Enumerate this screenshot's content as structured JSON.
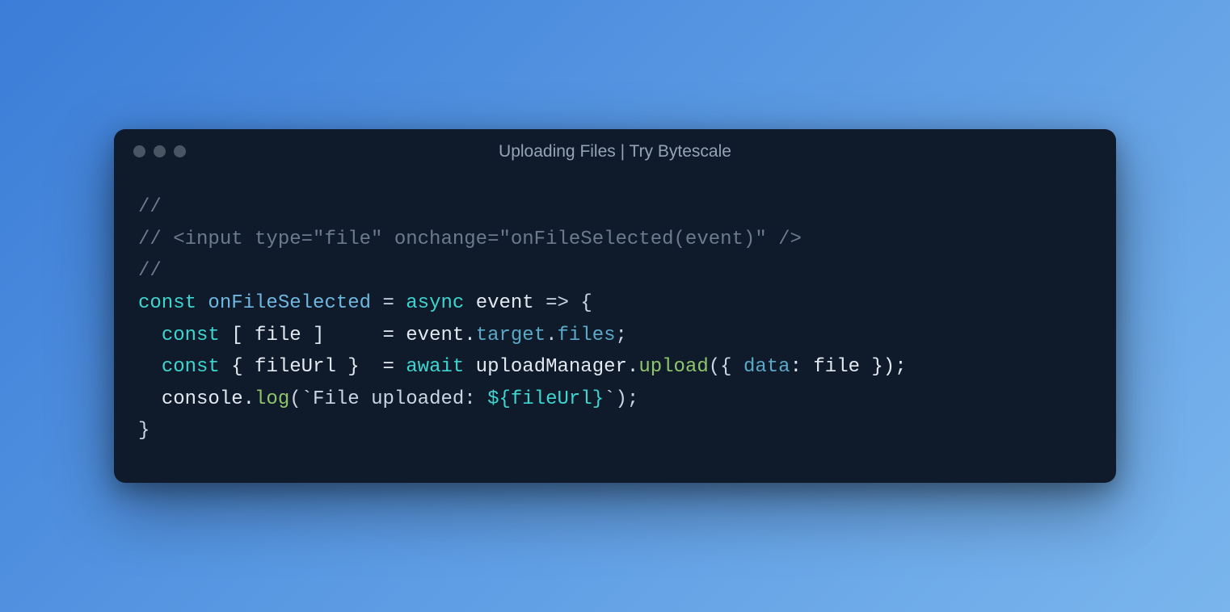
{
  "window": {
    "title": "Uploading Files | Try Bytescale"
  },
  "code": {
    "line1_comment": "//",
    "line2_comment": "// <input type=\"file\" onchange=\"onFileSelected(event)\" />",
    "line3_comment": "//",
    "l4_const": "const",
    "l4_fn": "onFileSelected",
    "l4_eq": " = ",
    "l4_async": "async",
    "l4_event": " event ",
    "l4_arrow": "=>",
    "l4_brace": " {",
    "l5_indent": "  ",
    "l5_const": "const",
    "l5_destr": " [ file ]     = event.",
    "l5_target": "target",
    "l5_dot": ".",
    "l5_files": "files",
    "l5_semi": ";",
    "l6_indent": "  ",
    "l6_const": "const",
    "l6_destr": " { fileUrl }  = ",
    "l6_await": "await",
    "l6_mgr": " uploadManager.",
    "l6_upload": "upload",
    "l6_open": "({ ",
    "l6_data": "data",
    "l6_rest": ": file });",
    "l7_indent": "  ",
    "l7_console": "console.",
    "l7_log": "log",
    "l7_open": "(",
    "l7_tick1": "`File uploaded: ",
    "l7_interp": "${fileUrl}",
    "l7_tick2": "`",
    "l7_close": ");",
    "l8_brace": "}"
  }
}
